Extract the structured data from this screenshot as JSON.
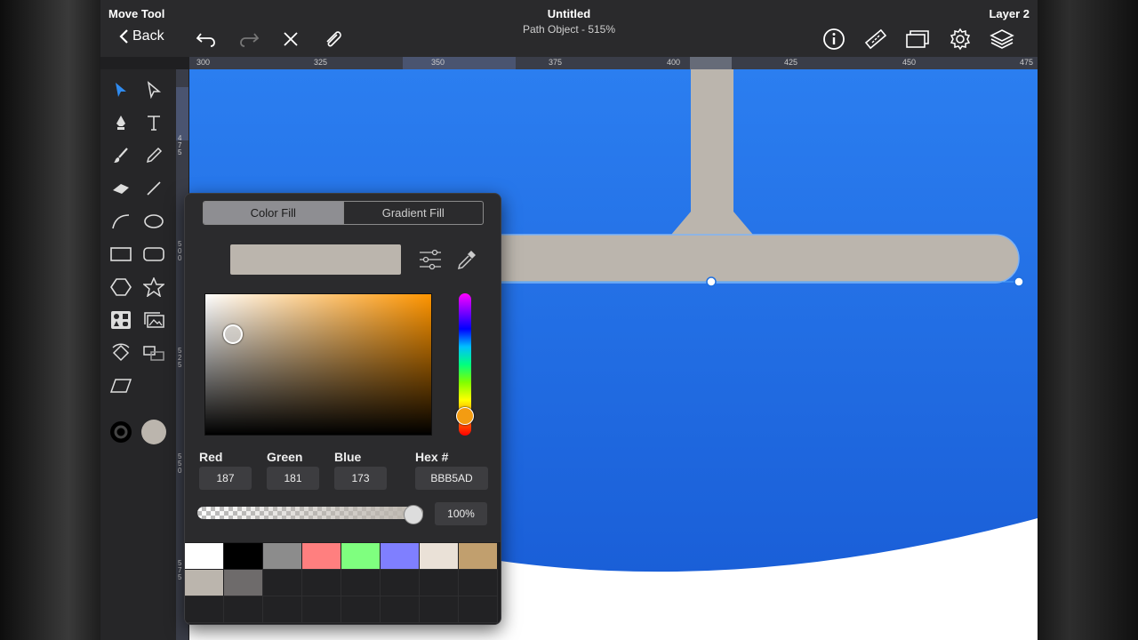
{
  "topbar": {
    "tool_name": "Move Tool",
    "back_label": "Back",
    "doc_title": "Untitled",
    "doc_subtitle": "Path Object - 515%",
    "layer_name": "Layer 2"
  },
  "ruler": {
    "top_labels": [
      "300",
      "325",
      "350",
      "375",
      "400",
      "425",
      "450",
      "475"
    ],
    "left_labels": [
      "4\n7\n5",
      "5\n0\n0",
      "5\n2\n5",
      "5\n5\n0",
      "5\n7\n5"
    ]
  },
  "color_panel": {
    "tabs": [
      "Color Fill",
      "Gradient Fill"
    ],
    "active_tab": "Color Fill",
    "current_color": "#BBB5AD",
    "hue_color": "#FF9500",
    "labels": {
      "red": "Red",
      "green": "Green",
      "blue": "Blue",
      "hex": "Hex #"
    },
    "values": {
      "red": "187",
      "green": "181",
      "blue": "173",
      "hex": "BBB5AD"
    },
    "opacity": "100%",
    "palette": [
      "#FFFFFF",
      "#000000",
      "#8C8C8C",
      "#FF7F7F",
      "#7FFF7F",
      "#7F7FFF",
      "#EAE1D7",
      "#C19F6E",
      "#BBB5AD",
      "#6E6B6B"
    ]
  },
  "canvas": {
    "background_color": "#1F73E6",
    "shape_color": "#BBB5AD",
    "fill_color": "#FFFFFF",
    "stroke_color": "#000000"
  }
}
